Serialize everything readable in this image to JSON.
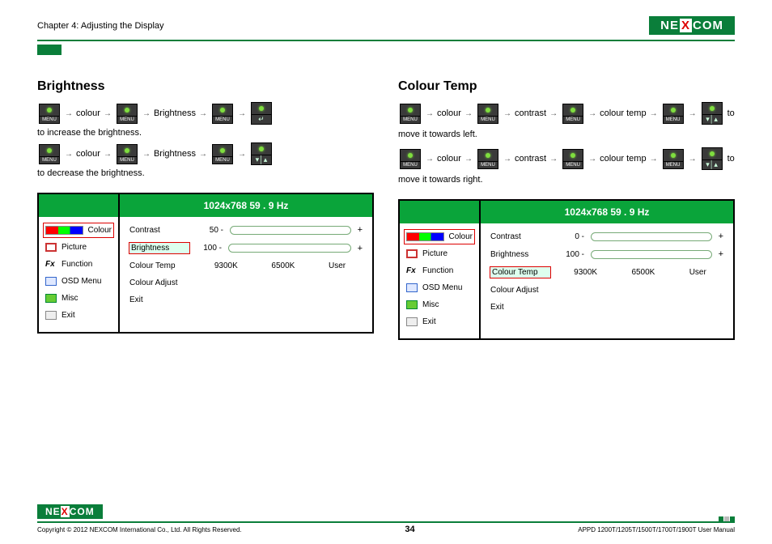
{
  "header": {
    "chapter": "Chapter 4: Adjusting the Display",
    "logo_a": "NE",
    "logo_x": "X",
    "logo_b": "COM"
  },
  "left": {
    "title": "Brightness",
    "steps": [
      {
        "t1": "colour",
        "t2": "Brightness",
        "tail": "to increase the brightness.",
        "last": "▲"
      },
      {
        "t1": "colour",
        "t2": "Brightness",
        "tail": "to decrease the brightness.",
        "last": "▾|▴"
      }
    ],
    "osd": {
      "res": "1024x768  59  . 9 Hz",
      "side": [
        {
          "label": "Colour",
          "sel": true,
          "ico": "col"
        },
        {
          "label": "Picture",
          "ico": "pic"
        },
        {
          "label": "Function",
          "ico": "fn",
          "fx": "Fx"
        },
        {
          "label": "OSD Menu",
          "ico": "osdm"
        },
        {
          "label": "Misc",
          "ico": "misc"
        },
        {
          "label": "Exit",
          "ico": "exit"
        }
      ],
      "rows": {
        "contrast_l": "Contrast",
        "contrast_v": "50 -",
        "contrast_fill": 50,
        "bright_l": "Brightness",
        "bright_v": "100 -",
        "bright_fill": 100,
        "bright_sel": true,
        "ct_l": "Colour Temp",
        "ct_o1": "9300K",
        "ct_o2": "6500K",
        "ct_o3": "User",
        "ca_l": "Colour Adjust",
        "ex_l": "Exit"
      }
    }
  },
  "right": {
    "title": "Colour Temp",
    "steps": [
      {
        "t1": "colour",
        "t2": "contrast",
        "t3": "colour temp",
        "tail": "to",
        "wrap": "move it towards left.",
        "last": "▾|▴"
      },
      {
        "t1": "colour",
        "t2": "contrast",
        "t3": "colour temp",
        "tail": "to",
        "wrap": "move it towards right.",
        "last": "▾|▴"
      }
    ],
    "osd": {
      "res": "1024x768  59  . 9 Hz",
      "side": [
        {
          "label": "Colour",
          "sel": true,
          "ico": "col"
        },
        {
          "label": "Picture",
          "ico": "pic"
        },
        {
          "label": "Function",
          "ico": "fn",
          "fx": "Fx"
        },
        {
          "label": "OSD Menu",
          "ico": "osdm"
        },
        {
          "label": "Misc",
          "ico": "misc"
        },
        {
          "label": "Exit",
          "ico": "exit"
        }
      ],
      "rows": {
        "contrast_l": "Contrast",
        "contrast_v": "0 -",
        "contrast_fill": 0,
        "bright_l": "Brightness",
        "bright_v": "100 -",
        "bright_fill": 100,
        "ct_l": "Colour Temp",
        "ct_o1": "9300K",
        "ct_o2": "6500K",
        "ct_o3": "User",
        "ct_sel": true,
        "ca_l": "Colour Adjust",
        "ex_l": "Exit"
      }
    }
  },
  "footer": {
    "copy": "Copyright © 2012 NEXCOM International Co., Ltd. All Rights Reserved.",
    "page": "34",
    "manual": "APPD 1200T/1205T/1500T/1700T/1900T User Manual"
  },
  "ui": {
    "menu": "MENU",
    "arrow": "→",
    "plus": "+",
    "minus": "-"
  }
}
